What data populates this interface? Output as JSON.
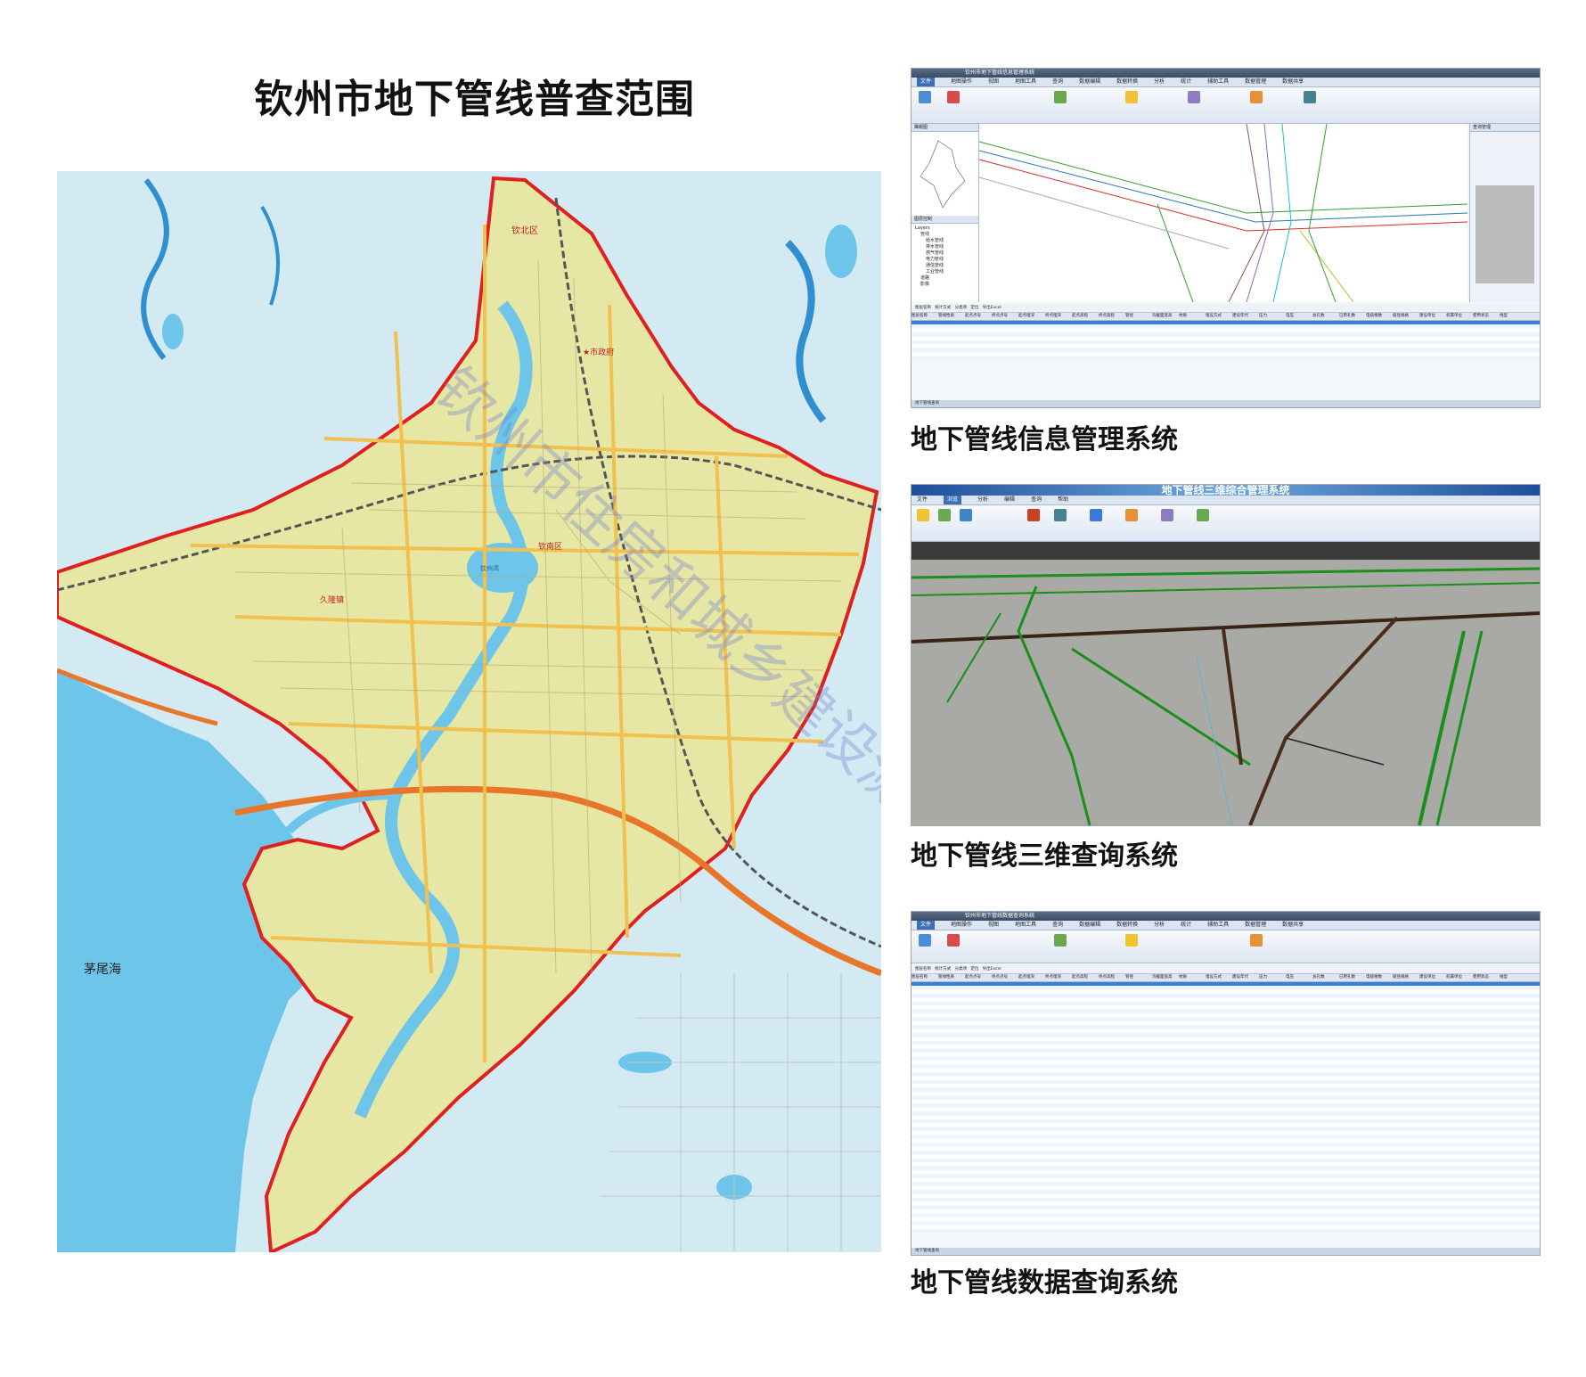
{
  "main_title": "钦州市地下管线普查范围",
  "map": {
    "labels": {
      "sea": "茅尾海",
      "district_north": "钦北区",
      "gov": "★市政府",
      "district_south": "钦南区",
      "town_west": "久隆镇",
      "lake": "钦州湾"
    },
    "watermark": "钦州市住房和城乡建设测绘院",
    "colors": {
      "water": "#6ec5ea",
      "land": "#d4eaf2",
      "survey_area": "#e6e7a5",
      "boundary": "#e02020",
      "road_main": "#f0c050",
      "highway": "#e8762a",
      "river_shallow": "#2f8fd0"
    }
  },
  "panels": [
    {
      "caption": "地下管线信息管理系统",
      "window_title": "钦州市地下管线信息管理系统",
      "tabs": [
        "文件",
        "地图操作",
        "视图",
        "地图工具",
        "查询",
        "数据编辑",
        "数据转换",
        "分析",
        "统计",
        "辅助工具",
        "数据管理",
        "数据共享"
      ],
      "active_tab": "文件",
      "layers": [
        "Layers",
        "管线",
        "给水管线",
        "排水管线",
        "燃气管线",
        "电力管线",
        "通信管线",
        "工业管线",
        "道路",
        "影像",
        "影像图"
      ],
      "grid_headers": [
        "图层名称",
        "管线性质",
        "起点点号",
        "终点点号",
        "起点埋深",
        "终点埋深",
        "起点高程",
        "终点高程",
        "管径",
        "沟截面宽高",
        "材质",
        "埋设方式",
        "建设年代",
        "压力",
        "电压",
        "总孔数",
        "已用孔数",
        "电缆根数",
        "缆径规格",
        "建设单位",
        "权属单位",
        "使用状态",
        "线型"
      ],
      "status": "地下管线查询"
    },
    {
      "caption": "地下管线三维查询系统",
      "window_title": "地下管线三维综合管理系统",
      "tabs": [
        "文件",
        "浏览",
        "分析",
        "编辑",
        "查询",
        "帮助"
      ],
      "active_tab": "浏览"
    },
    {
      "caption": "地下管线数据查询系统",
      "window_title": "钦州市地下管线数据查询系统",
      "tabs": [
        "文件",
        "地图操作",
        "视图",
        "地图工具",
        "查询",
        "数据编辑",
        "数据转换",
        "分析",
        "统计",
        "辅助工具",
        "数据管理",
        "数据共享"
      ],
      "active_tab": "文件",
      "grid_headers": [
        "图层名称",
        "管线性质",
        "起点点号",
        "终点点号",
        "起点埋深",
        "终点埋深",
        "起点高程",
        "终点高程",
        "管径",
        "沟截面宽高",
        "材质",
        "埋设方式",
        "建设年代",
        "压力",
        "电压",
        "总孔数",
        "已用孔数",
        "电缆根数",
        "缆径规格",
        "建设单位",
        "权属单位",
        "使用状态",
        "线型"
      ],
      "status": "地下管线查询"
    }
  ]
}
